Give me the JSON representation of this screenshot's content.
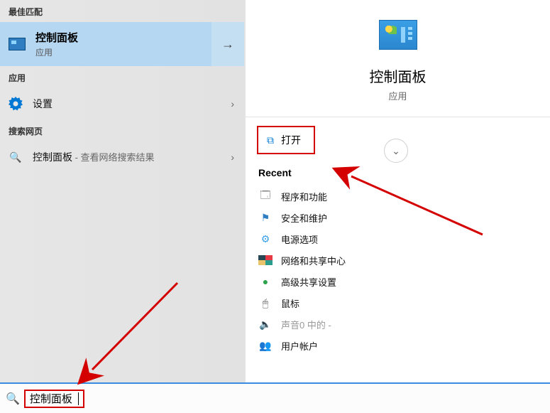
{
  "left": {
    "best_match_header": "最佳匹配",
    "best_match": {
      "title": "控制面板",
      "subtitle": "应用"
    },
    "apps_header": "应用",
    "apps": [
      {
        "label": "设置"
      }
    ],
    "web_header": "搜索网页",
    "web": [
      {
        "label": "控制面板",
        "hint": " - 查看网络搜索结果"
      }
    ]
  },
  "right": {
    "preview_title": "控制面板",
    "preview_subtitle": "应用",
    "open_label": "打开",
    "recent_header": "Recent",
    "recent": [
      {
        "icon": "🗔",
        "cls": "c1",
        "label": "程序和功能"
      },
      {
        "icon": "⚑",
        "cls": "c2",
        "label": "安全和维护"
      },
      {
        "icon": "⚙",
        "cls": "c3",
        "label": "电源选项"
      },
      {
        "icon": "█",
        "cls": "c-multi",
        "label": "网络和共享中心"
      },
      {
        "icon": "●",
        "cls": "c4",
        "label": "高级共享设置"
      },
      {
        "icon": "🖱",
        "cls": "c5",
        "label": "鼠标"
      },
      {
        "icon": "🔈",
        "cls": "c5",
        "label": "声音0 中的 -",
        "muted": true
      },
      {
        "icon": "👥",
        "cls": "c1",
        "label": "用户帐户"
      }
    ]
  },
  "search": {
    "value": "控制面板"
  }
}
